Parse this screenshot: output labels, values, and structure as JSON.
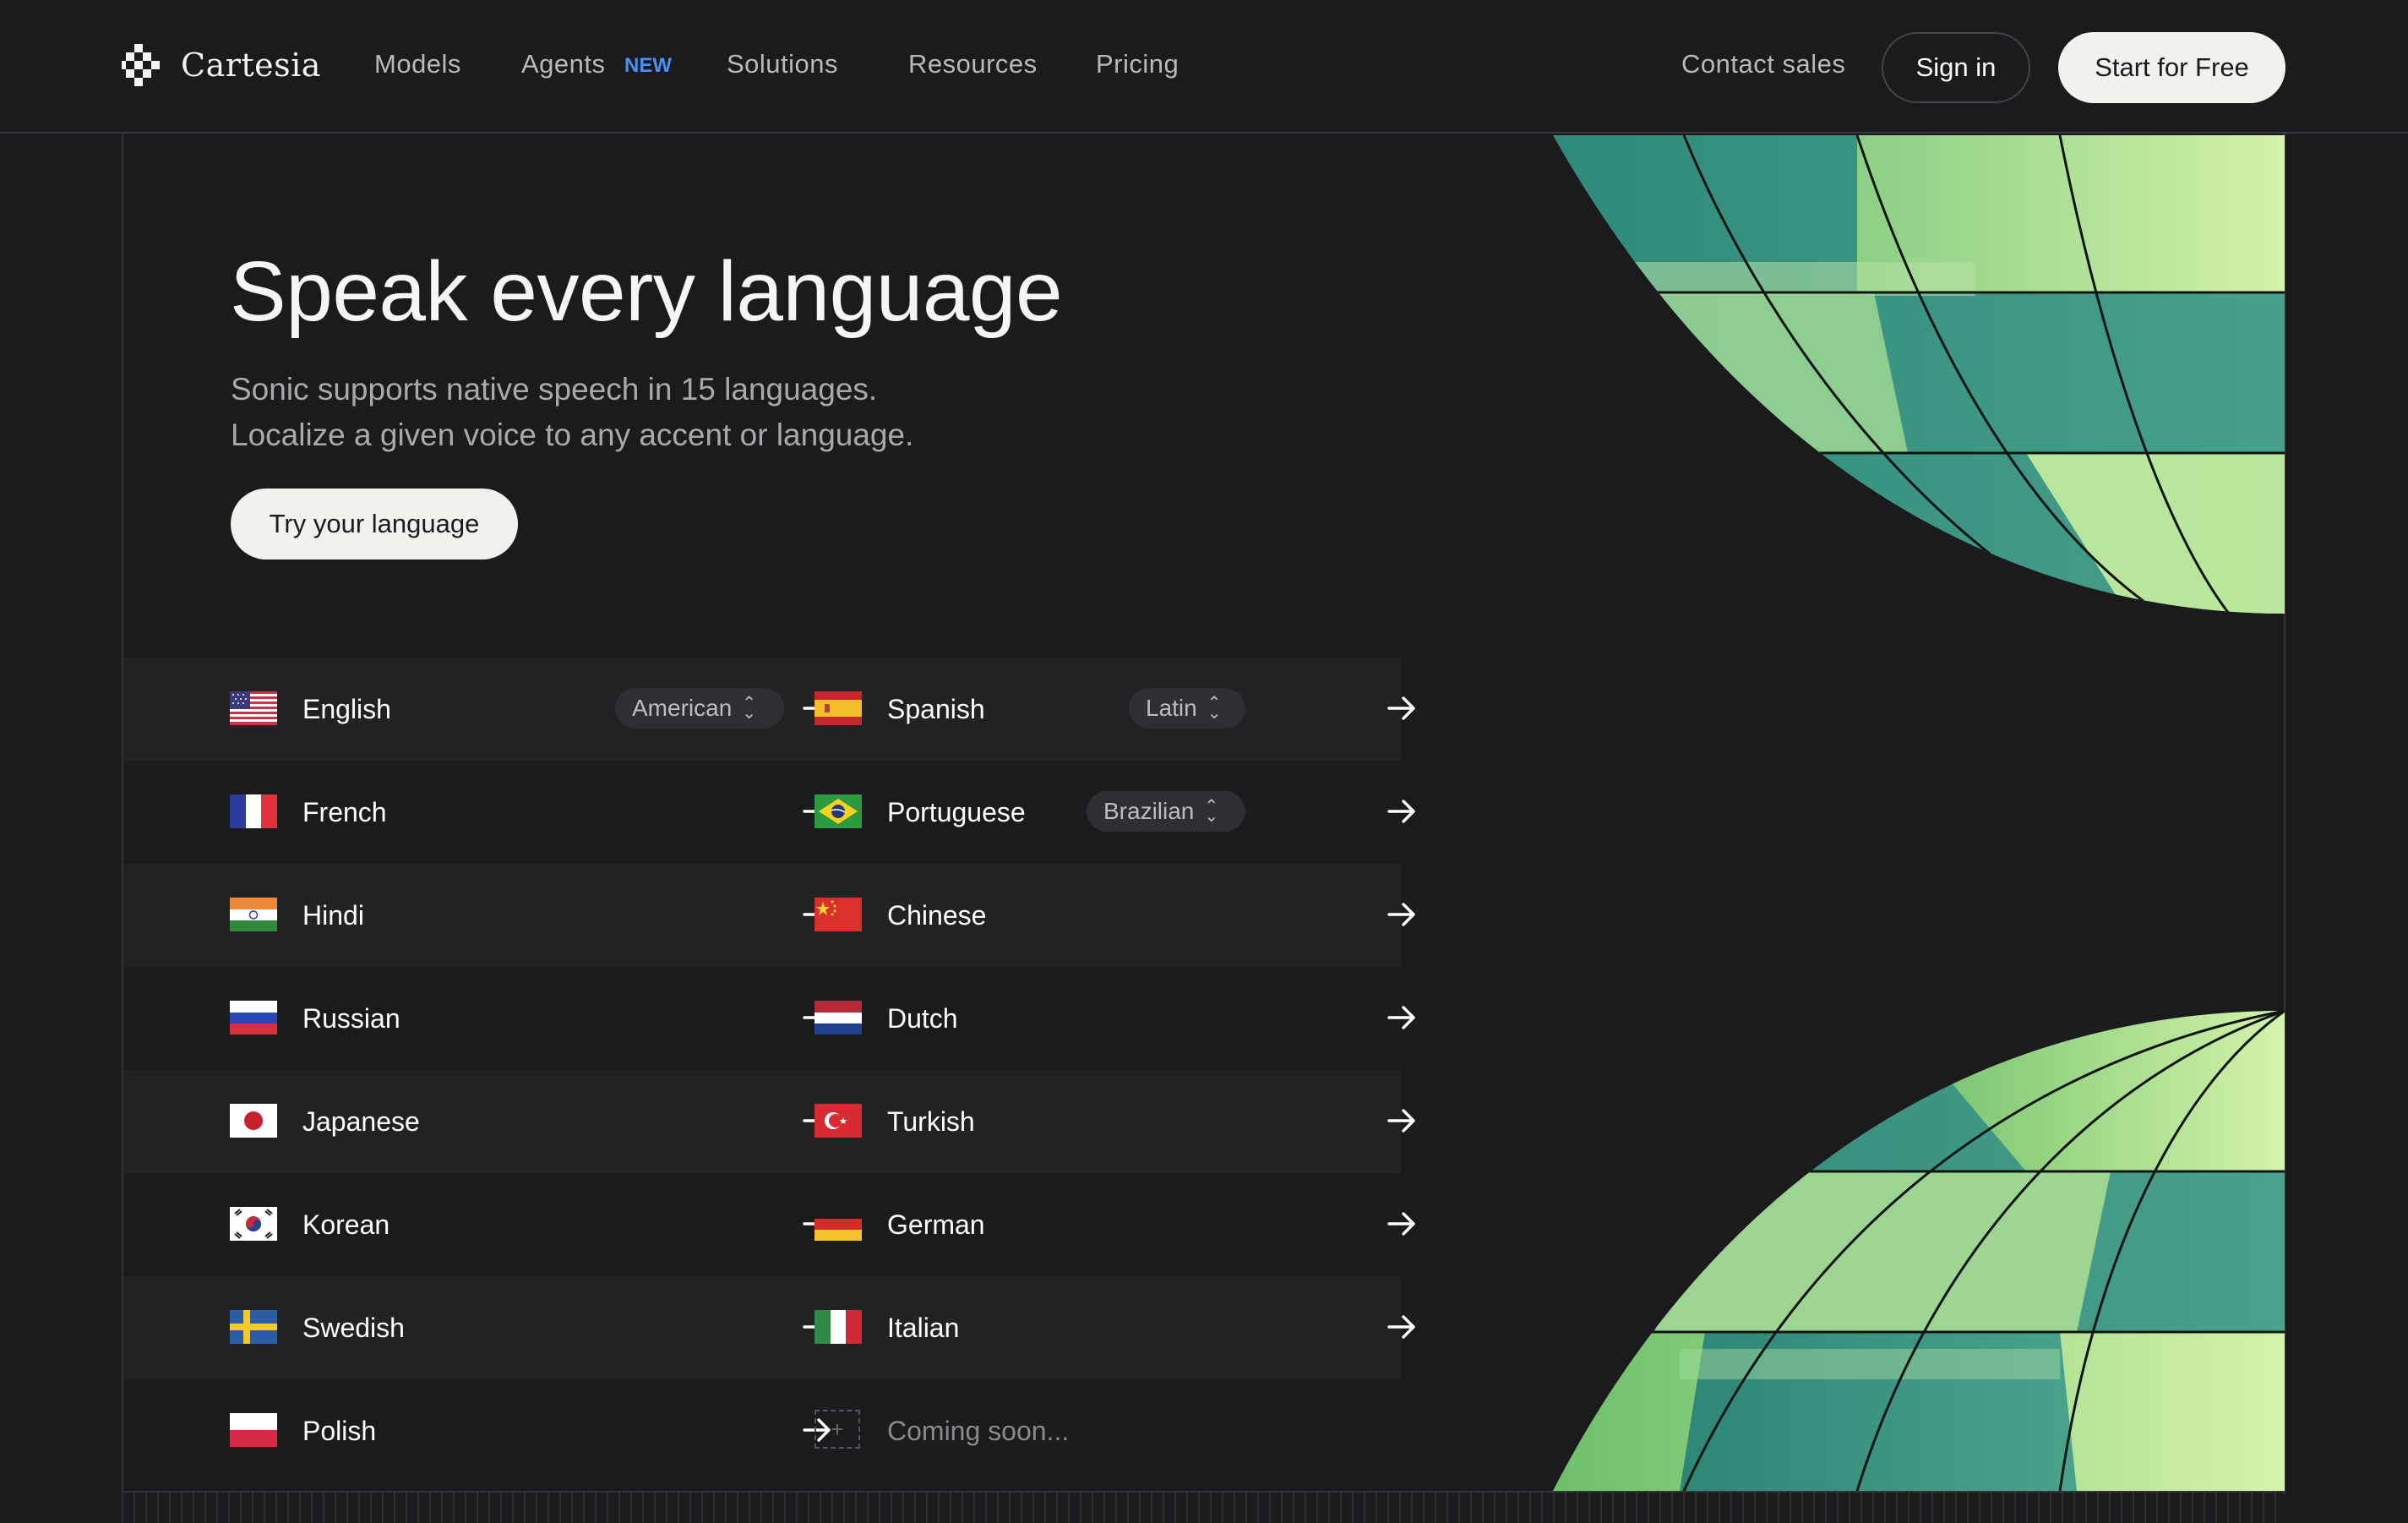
{
  "nav": {
    "brand": "Cartesia",
    "links": [
      "Models",
      "Agents",
      "Solutions",
      "Resources",
      "Pricing"
    ],
    "agents_badge": "NEW",
    "contact": "Contact sales",
    "sign_in": "Sign in",
    "start": "Start for Free"
  },
  "hero": {
    "title": "Speak every language",
    "subtitle_line1": "Sonic supports native speech in 15 languages.",
    "subtitle_line2": "Localize a given voice to any accent or language.",
    "cta": "Try your language"
  },
  "languages": {
    "left": [
      {
        "name": "English",
        "flag": "us-flag",
        "variant": "American"
      },
      {
        "name": "French",
        "flag": "fr-flag"
      },
      {
        "name": "Hindi",
        "flag": "in-flag"
      },
      {
        "name": "Russian",
        "flag": "ru-flag"
      },
      {
        "name": "Japanese",
        "flag": "jp-flag"
      },
      {
        "name": "Korean",
        "flag": "kr-flag"
      },
      {
        "name": "Swedish",
        "flag": "se-flag"
      },
      {
        "name": "Polish",
        "flag": "pl-flag"
      }
    ],
    "right": [
      {
        "name": "Spanish",
        "flag": "es-flag",
        "variant": "Latin"
      },
      {
        "name": "Portuguese",
        "flag": "br-flag",
        "variant": "Brazilian"
      },
      {
        "name": "Chinese",
        "flag": "cn-flag"
      },
      {
        "name": "Dutch",
        "flag": "nl-flag"
      },
      {
        "name": "Turkish",
        "flag": "tr-flag"
      },
      {
        "name": "German",
        "flag": "de-flag"
      },
      {
        "name": "Italian",
        "flag": "it-flag"
      },
      {
        "name": "Coming soon...",
        "flag": "plus-icon"
      }
    ]
  },
  "colors": {
    "background": "#1b1a1d",
    "row_shade": "#222124",
    "accent_badge": "#4c8ff5",
    "globe_teal": "#3a9684",
    "globe_lime": "#bfe89a"
  }
}
